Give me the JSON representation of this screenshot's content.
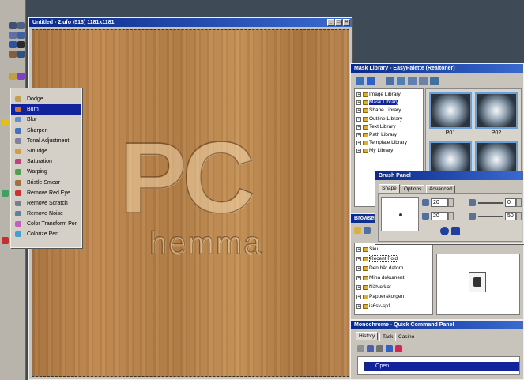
{
  "canvas_window": {
    "title": "Untitled - 2.ufo (513) 1181x1181",
    "btn_min": "_",
    "btn_max": "□",
    "btn_close": "×"
  },
  "watermark": {
    "logo_text": "PC",
    "sub_text": "hemma"
  },
  "context_menu": {
    "items": [
      {
        "label": "Dodge",
        "color": "#c0a050"
      },
      {
        "label": "Burn",
        "color": "#d07030"
      },
      {
        "label": "Blur",
        "color": "#6090d0"
      },
      {
        "label": "Sharpen",
        "color": "#4070c0"
      },
      {
        "label": "Tonal Adjustment",
        "color": "#8080a0"
      },
      {
        "label": "Smudge",
        "color": "#d0a040"
      },
      {
        "label": "Saturation",
        "color": "#c04080"
      },
      {
        "label": "Warping",
        "color": "#50a050"
      },
      {
        "label": "Bristle Smear",
        "color": "#a07040"
      },
      {
        "label": "Remove Red Eye",
        "color": "#d03030"
      },
      {
        "label": "Remove Scratch",
        "color": "#708090"
      },
      {
        "label": "Remove Noise",
        "color": "#6080a0"
      },
      {
        "label": "Color Transform Pen",
        "color": "#c060c0"
      },
      {
        "label": "Colorize Pen",
        "color": "#40a0d0"
      }
    ],
    "selected_index": 1
  },
  "mask_library": {
    "title": "Mask Library - EasyPalette (Realtoner)",
    "tree": [
      "Image Library",
      "Mask Library",
      "Shape Library",
      "Outline Library",
      "Text Library",
      "Path Library",
      "Template Library",
      "My Library"
    ],
    "selected_tree_index": 1,
    "thumbs": [
      "P01",
      "P02"
    ]
  },
  "brush_panel": {
    "title": "Brush Panel",
    "tabs": [
      "Shape",
      "Options",
      "Advanced"
    ],
    "active_tab_index": 0,
    "size_value": "20",
    "soft_value": "20",
    "right_value_1": "0",
    "right_value_2": "50"
  },
  "browser": {
    "title": "Browser",
    "tree": [
      {
        "label": "Sku"
      },
      {
        "label": "Recent Fold"
      },
      {
        "label": "Den här datorn"
      },
      {
        "label": "Mina dokument"
      },
      {
        "label": "Nätverkat"
      },
      {
        "label": "Papperskorgen"
      },
      {
        "label": "is6sv-sp1"
      }
    ]
  },
  "quick_command": {
    "title": "Monochrome - Quick Command Panel",
    "tabs": [
      "History",
      "Task",
      "Casino"
    ],
    "active_tab_index": 0,
    "history_item": "Open"
  },
  "colors": {
    "title_bar": "#0a2a8a",
    "selection": "#11229a",
    "workspace": "#3e4a55",
    "wood": "#b8844c"
  }
}
